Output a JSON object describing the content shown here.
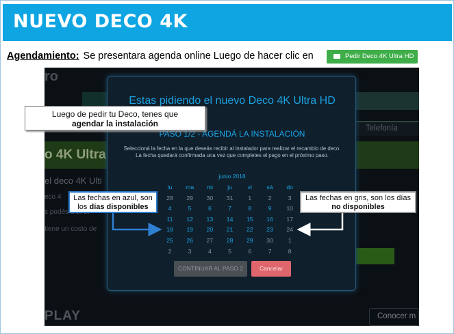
{
  "header": {
    "title": "NUEVO DECO 4K"
  },
  "instruction": {
    "label": "Agendamiento:",
    "text": "Se presentara agenda online Luego de hacer clic en",
    "button_label": "Pedir Deco 4K Ultra HD"
  },
  "background_page": {
    "logo_fragment": "ro",
    "tab_label": "Telefonía",
    "heading_fragment": "o 4K Ultra H",
    "line1": "el deco 4K Ulti",
    "line2": "eco 4",
    "line3": "s podés disfrut",
    "line4": "tiene un costo de",
    "brand_fragment": "PLAY",
    "conocer_label": "Conocer m"
  },
  "modal": {
    "title": "Estas pidiendo el nuevo Deco 4K Ultra HD",
    "step": "PASO 1/2 - AGENDÁ LA INSTALACIÓN",
    "description": "Seleccioná la fecha en la que deseás recibir al instalador para realizar el recambio de deco. La fecha quedará confirmada una vez que completes el pago en el próximo paso.",
    "month": "junio 2018",
    "weekdays": [
      "lu",
      "ma",
      "mi",
      "ju",
      "vi",
      "sá",
      "do"
    ],
    "weeks": [
      [
        {
          "d": "28",
          "s": "g"
        },
        {
          "d": "29",
          "s": "g"
        },
        {
          "d": "30",
          "s": "g"
        },
        {
          "d": "31",
          "s": "g"
        },
        {
          "d": "1",
          "s": "g"
        },
        {
          "d": "2",
          "s": "g"
        },
        {
          "d": "3",
          "s": "g"
        }
      ],
      [
        {
          "d": "4",
          "s": "a"
        },
        {
          "d": "5",
          "s": "a"
        },
        {
          "d": "6",
          "s": "a"
        },
        {
          "d": "7",
          "s": "a"
        },
        {
          "d": "8",
          "s": "a"
        },
        {
          "d": "9",
          "s": "a"
        },
        {
          "d": "10",
          "s": "g"
        }
      ],
      [
        {
          "d": "11",
          "s": "a"
        },
        {
          "d": "12",
          "s": "a"
        },
        {
          "d": "13",
          "s": "a"
        },
        {
          "d": "14",
          "s": "a"
        },
        {
          "d": "15",
          "s": "a"
        },
        {
          "d": "16",
          "s": "a"
        },
        {
          "d": "17",
          "s": "g"
        }
      ],
      [
        {
          "d": "18",
          "s": "a"
        },
        {
          "d": "19",
          "s": "a"
        },
        {
          "d": "20",
          "s": "a"
        },
        {
          "d": "21",
          "s": "a"
        },
        {
          "d": "22",
          "s": "a"
        },
        {
          "d": "23",
          "s": "a"
        },
        {
          "d": "24",
          "s": "g"
        }
      ],
      [
        {
          "d": "25",
          "s": "a"
        },
        {
          "d": "26",
          "s": "a"
        },
        {
          "d": "27",
          "s": "g"
        },
        {
          "d": "28",
          "s": "a"
        },
        {
          "d": "29",
          "s": "a"
        },
        {
          "d": "30",
          "s": "g"
        },
        {
          "d": "1",
          "s": "g"
        }
      ],
      [
        {
          "d": "2",
          "s": "g"
        },
        {
          "d": "3",
          "s": "g"
        },
        {
          "d": "4",
          "s": "g"
        },
        {
          "d": "5",
          "s": "g"
        },
        {
          "d": "6",
          "s": "g"
        },
        {
          "d": "7",
          "s": "g"
        },
        {
          "d": "8",
          "s": "g"
        }
      ]
    ],
    "continue_label": "CONTINUAR AL PASO 2",
    "cancel_label": "Cancelar"
  },
  "callouts": {
    "top_line1": "Luego de pedir tu Deco, tenes que",
    "top_line2": "agendar la instalación",
    "left_line1": "Las fechas en azul, son",
    "left_line2_prefix": "los",
    "left_line2_bold": "días disponibles",
    "right_line1": "Las fechas en gris, son los días",
    "right_line2_bold": "no disponibles"
  },
  "colors": {
    "header_bg": "#0ea5e2",
    "button_green": "#3fae49",
    "available_date": "#1ba4e4",
    "unavailable_date": "#8a939c",
    "cancel_button": "#e0666e"
  }
}
